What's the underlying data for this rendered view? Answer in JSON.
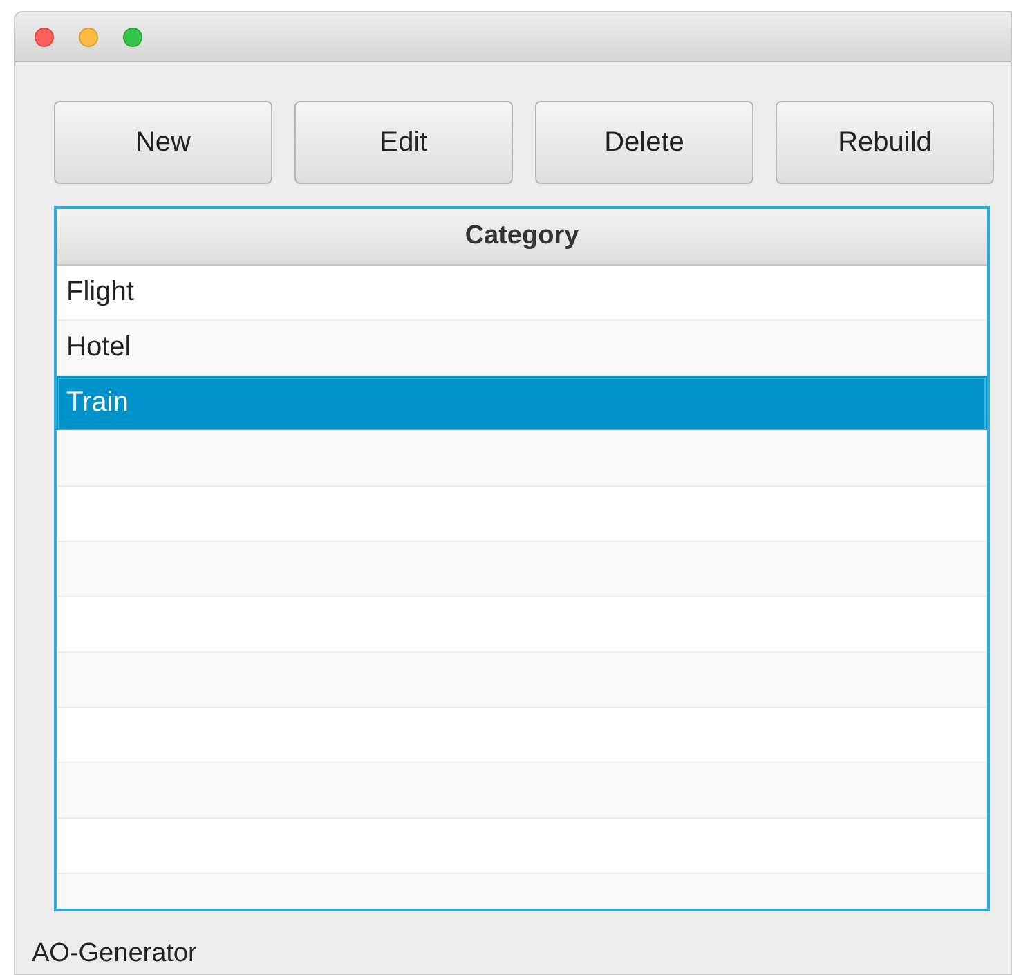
{
  "toolbar": {
    "buttons": [
      {
        "label": "New"
      },
      {
        "label": "Edit"
      },
      {
        "label": "Delete"
      },
      {
        "label": "Rebuild"
      }
    ]
  },
  "table": {
    "columns": [
      "Category"
    ],
    "rows": [
      {
        "category": "Flight",
        "selected": false
      },
      {
        "category": "Hotel",
        "selected": false
      },
      {
        "category": "Train",
        "selected": true
      }
    ]
  },
  "status_bar": {
    "text": "AO-Generator"
  }
}
